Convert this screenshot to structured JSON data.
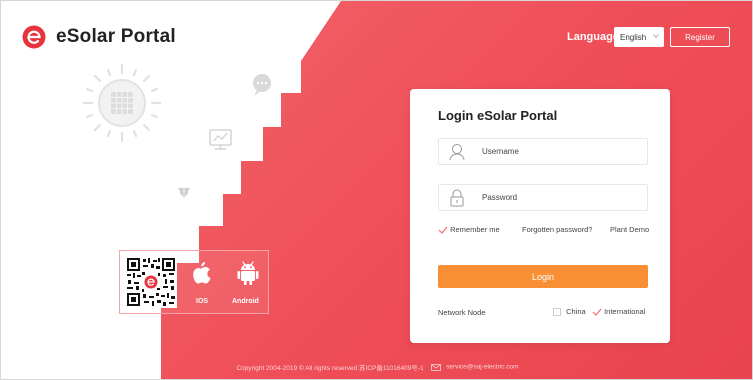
{
  "header": {
    "app_name": "eSolar Portal",
    "language_label": "Language",
    "language_value": "English",
    "register_label": "Register"
  },
  "apps": {
    "ios_label": "IOS",
    "android_label": "Android"
  },
  "login": {
    "title": "Login eSolar Portal",
    "username_placeholder": "Username",
    "password_placeholder": "Password",
    "remember_me": "Remember me",
    "remember_checked": true,
    "forgot_password": "Forgotten password?",
    "plant_demo": "Plant Demo",
    "login_button": "Login",
    "network_node_label": "Network Node",
    "node_china": "China",
    "node_international": "International",
    "node_selected": "International"
  },
  "footer": {
    "copyright": "Copyright 2004-2019 © All rights reserved 苏ICP备11016409号-1",
    "email": "service@saj-electric.com"
  },
  "colors": {
    "brand_red": "#ef4f58",
    "login_orange": "#f88f35"
  }
}
